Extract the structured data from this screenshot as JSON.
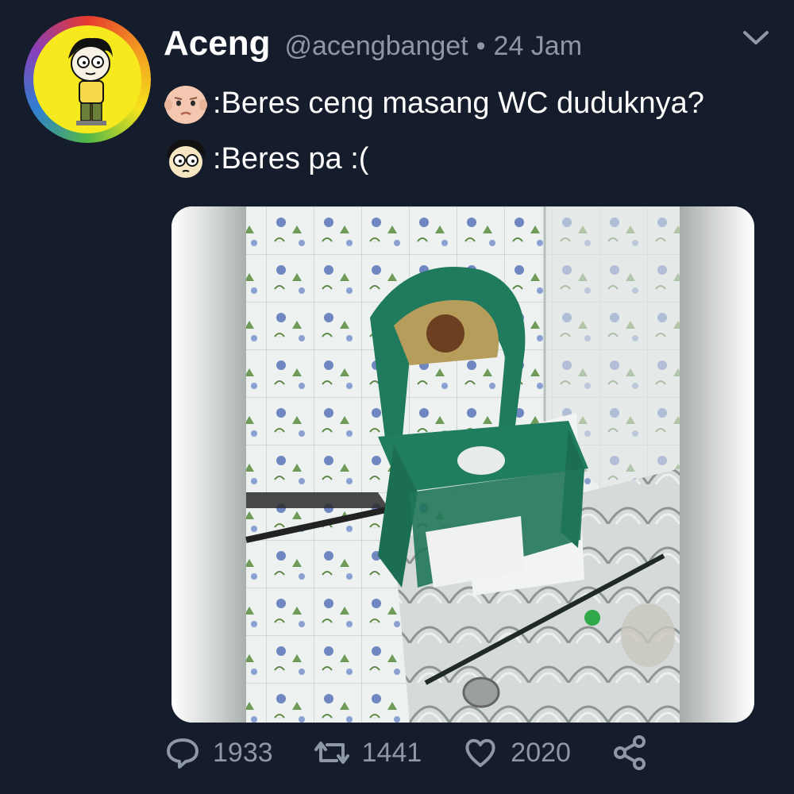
{
  "tweet": {
    "author_name": "Aceng",
    "handle": "@acengbanget",
    "separator": "•",
    "time": "24 Jam",
    "lines": [
      ":Beres ceng masang WC duduknya?",
      ":Beres pa :("
    ],
    "icons": {
      "avatar": "cartoon-boy-avatar",
      "menu": "chevron-down-icon",
      "line1_face": "baby-face-emoji",
      "line2_face": "cartoon-boy-face"
    }
  },
  "actions": {
    "replies": "1933",
    "retweets": "1441",
    "likes": "2020"
  },
  "colors": {
    "background": "#151c2b",
    "muted_text": "#8e97a6",
    "text": "#ffffff"
  }
}
